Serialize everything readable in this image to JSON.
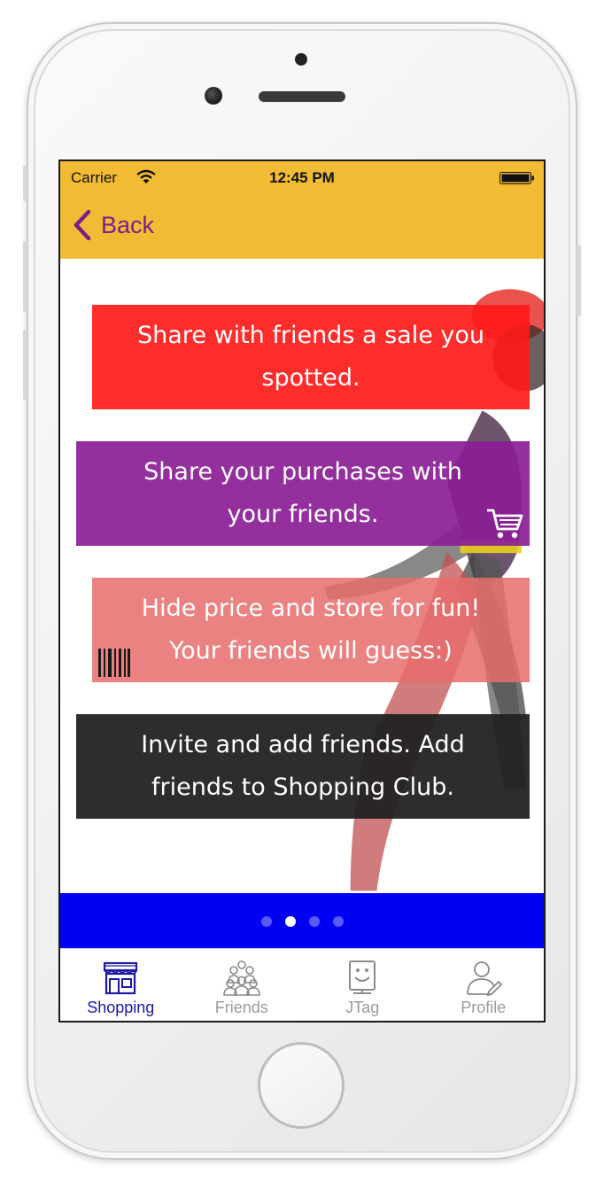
{
  "status_bar": {
    "carrier": "Carrier",
    "time": "12:45 PM"
  },
  "nav": {
    "back_label": "Back"
  },
  "cards": [
    {
      "text_line1": "Share with friends a sale you",
      "text_line2": "spotted."
    },
    {
      "text_line1": "Share your purchases with",
      "text_line2": "your friends.",
      "icon": "cart-icon"
    },
    {
      "text_line1": "Hide price and store for fun!",
      "text_line2": "Your friends will guess:)",
      "icon": "barcode-icon"
    },
    {
      "text_line1": "Invite and add friends. Add",
      "text_line2": "friends to Shopping Club."
    }
  ],
  "pager": {
    "page_count": 4,
    "active_index": 1
  },
  "tabs": [
    {
      "label": "Shopping",
      "icon": "store-icon",
      "active": true
    },
    {
      "label": "Friends",
      "icon": "friends-icon",
      "active": false
    },
    {
      "label": "JTag",
      "icon": "jtag-icon",
      "active": false
    },
    {
      "label": "Profile",
      "icon": "profile-icon",
      "active": false
    }
  ],
  "colors": {
    "header": "#f1bc33",
    "back_text": "#7a1e8c",
    "card_red": "#ff1a1a",
    "card_purple": "#8a1e96",
    "card_pink": "#e86e6e",
    "card_black": "#222222",
    "pager_bar": "#0000f5",
    "tab_active": "#1a1aa6",
    "tab_inactive": "#9a9a9a"
  }
}
